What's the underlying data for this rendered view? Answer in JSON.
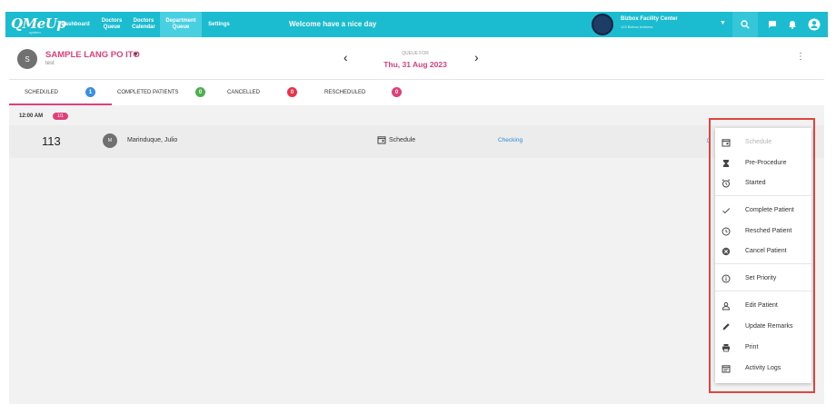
{
  "brand": {
    "logo_text": "QMeUp",
    "logo_sub": "system"
  },
  "nav": [
    {
      "label_line1": "Dashboard",
      "label_line2": ""
    },
    {
      "label_line1": "Doctors",
      "label_line2": "Queue"
    },
    {
      "label_line1": "Doctors",
      "label_line2": "Calendar"
    },
    {
      "label_line1": "Department",
      "label_line2": "Queue",
      "active": true
    },
    {
      "label_line1": "Settings",
      "label_line2": ""
    }
  ],
  "welcome": "Welcome have a nice day",
  "facility": {
    "name": "Bizbox Facility Center",
    "sub": "123 Bizbox Address"
  },
  "department": {
    "initial": "S",
    "name": "SAMPLE LANG PO ITO",
    "sub": "test"
  },
  "queue": {
    "label": "QUEUE FOR",
    "date": "Thu, 31 Aug 2023"
  },
  "tabs": [
    {
      "label": "SCHEDULED",
      "count": "1",
      "color": "#3b8fe0"
    },
    {
      "label": "COMPLETED PATIENTS",
      "count": "0",
      "color": "#4caf50"
    },
    {
      "label": "CANCELLED",
      "count": "0",
      "color": "#e8334a"
    },
    {
      "label": "RESCHEDULED",
      "count": "0",
      "color": "#e0407a"
    }
  ],
  "time_group": {
    "time": "12:00 AM",
    "count": "1/1"
  },
  "row": {
    "queue_number": "113",
    "patient_initial": "M",
    "patient_name": "Marinduque, Julio",
    "status": "Schedule",
    "action_status": "Checking",
    "partial": "D"
  },
  "menu": [
    {
      "label": "Schedule",
      "icon": "calendar-icon",
      "disabled": true
    },
    {
      "label": "Pre-Procedure",
      "icon": "hourglass-icon"
    },
    {
      "label": "Started",
      "icon": "alarm-icon"
    },
    {
      "label": "Complete Patient",
      "icon": "check-icon"
    },
    {
      "label": "Resched Patient",
      "icon": "clock-icon"
    },
    {
      "label": "Cancel Patient",
      "icon": "cancel-icon"
    },
    {
      "label": "Set Priority",
      "icon": "info-icon"
    },
    {
      "label": "Edit Patient",
      "icon": "person-icon"
    },
    {
      "label": "Update Remarks",
      "icon": "pencil-icon"
    },
    {
      "label": "Print",
      "icon": "printer-icon"
    },
    {
      "label": "Activity Logs",
      "icon": "calendar-list-icon"
    }
  ],
  "colors": {
    "topbar": "#1bbcd0",
    "accent": "#e0407a",
    "link": "#2f8ad6",
    "highlight": "#e0453f"
  }
}
